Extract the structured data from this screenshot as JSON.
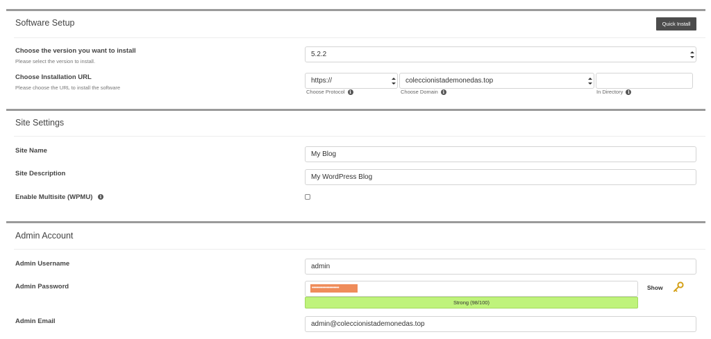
{
  "software_setup": {
    "title": "Software Setup",
    "quick_install_label": "Quick Install",
    "version": {
      "label": "Choose the version you want to install",
      "sublabel": "Please select the version to install.",
      "value": "5.2.2"
    },
    "url": {
      "label": "Choose Installation URL",
      "sublabel": "Please choose the URL to install the software",
      "protocol_value": "https://",
      "protocol_hint": "Choose Protocol",
      "domain_value": "coleccionistademonedas.top",
      "domain_hint": "Choose Domain",
      "directory_value": "",
      "directory_hint": "In Directory"
    }
  },
  "site_settings": {
    "title": "Site Settings",
    "site_name_label": "Site Name",
    "site_name_value": "My Blog",
    "site_description_label": "Site Description",
    "site_description_value": "My WordPress Blog",
    "multisite_label": "Enable Multisite (WPMU)",
    "multisite_checked": false
  },
  "admin_account": {
    "title": "Admin Account",
    "username_label": "Admin Username",
    "username_value": "admin",
    "password_label": "Admin Password",
    "password_mask": "••••••••••••••••••••",
    "strength_text": "Strong (98/100)",
    "show_label": "Show",
    "email_label": "Admin Email",
    "email_value": "admin@coleccionistademonedas.top"
  },
  "icons": {
    "info": "info-icon",
    "key": "key-icon",
    "select_caret": "chevron-updown-icon"
  },
  "colors": {
    "section_bar": "#9a9a9a",
    "quick_install_bg": "#4c4c4c",
    "password_highlight": "#ef8c5a",
    "strength_bar": "#bff37b",
    "key_icon": "#d4a017"
  }
}
